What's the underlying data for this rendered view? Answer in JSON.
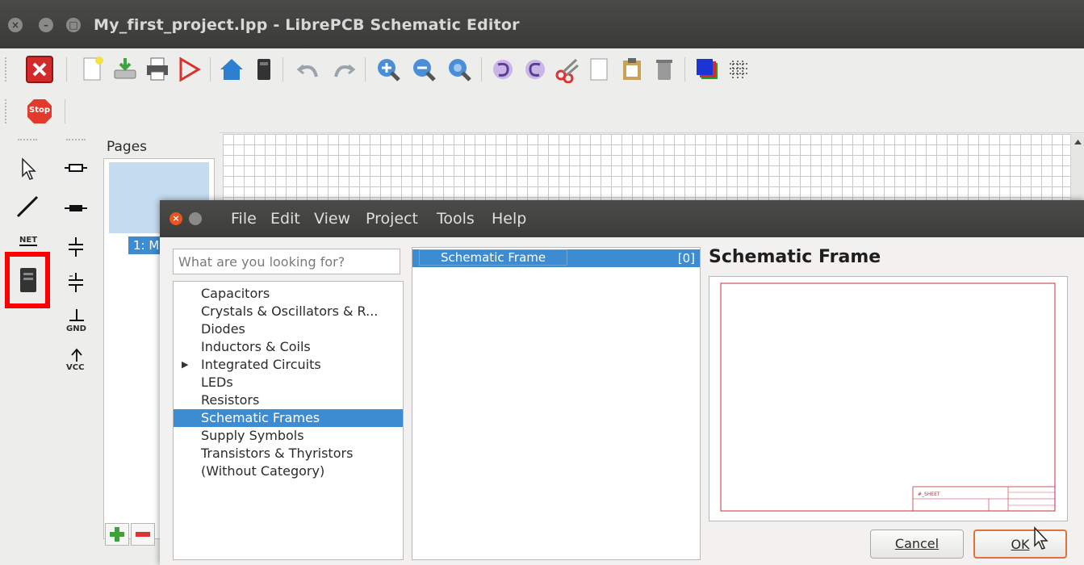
{
  "window": {
    "title": "My_first_project.lpp - LibrePCB Schematic Editor"
  },
  "toolbar_main": {
    "icons": [
      "close-project-icon",
      "new-sheet-icon",
      "save-icon",
      "print-icon",
      "export-pdf-icon",
      "control-panel-icon",
      "board-editor-icon",
      "undo-icon",
      "redo-icon",
      "zoom-in-icon",
      "zoom-out-icon",
      "zoom-all-icon",
      "rotate-ccw-icon",
      "rotate-cw-icon",
      "cut-icon",
      "copy-icon",
      "paste-icon",
      "remove-icon",
      "layers-icon",
      "grid-icon"
    ]
  },
  "toolbar_stop": {
    "stop_label": "Stop"
  },
  "left_tools": {
    "net_label": "NET",
    "gnd_label": "GND",
    "vcc_label": "VCC"
  },
  "pages": {
    "header": "Pages",
    "first_page": "1: M"
  },
  "dialog": {
    "menu": [
      "File",
      "Edit",
      "View",
      "Project",
      "Tools",
      "Help"
    ],
    "search_placeholder": "What are you looking for?",
    "categories": [
      {
        "label": "Capacitors",
        "selected": false,
        "expandable": false
      },
      {
        "label": "Crystals & Oscillators & R...",
        "selected": false,
        "expandable": false
      },
      {
        "label": "Diodes",
        "selected": false,
        "expandable": false
      },
      {
        "label": "Inductors & Coils",
        "selected": false,
        "expandable": false
      },
      {
        "label": "Integrated Circuits",
        "selected": false,
        "expandable": true
      },
      {
        "label": "LEDs",
        "selected": false,
        "expandable": false
      },
      {
        "label": "Resistors",
        "selected": false,
        "expandable": false
      },
      {
        "label": "Schematic Frames",
        "selected": true,
        "expandable": false
      },
      {
        "label": "Supply Symbols",
        "selected": false,
        "expandable": false
      },
      {
        "label": "Transistors & Thyristors",
        "selected": false,
        "expandable": false
      },
      {
        "label": "(Without Category)",
        "selected": false,
        "expandable": false
      }
    ],
    "components": [
      {
        "name": "Schematic Frame",
        "count": "[0]"
      }
    ],
    "preview_title": "Schematic Frame",
    "preview_frame_label": "#_SHEET",
    "cancel_label": "Cancel",
    "ok_label": "OK",
    "accent_color": "#3d8bd0",
    "highlight_color": "#ff0000"
  }
}
